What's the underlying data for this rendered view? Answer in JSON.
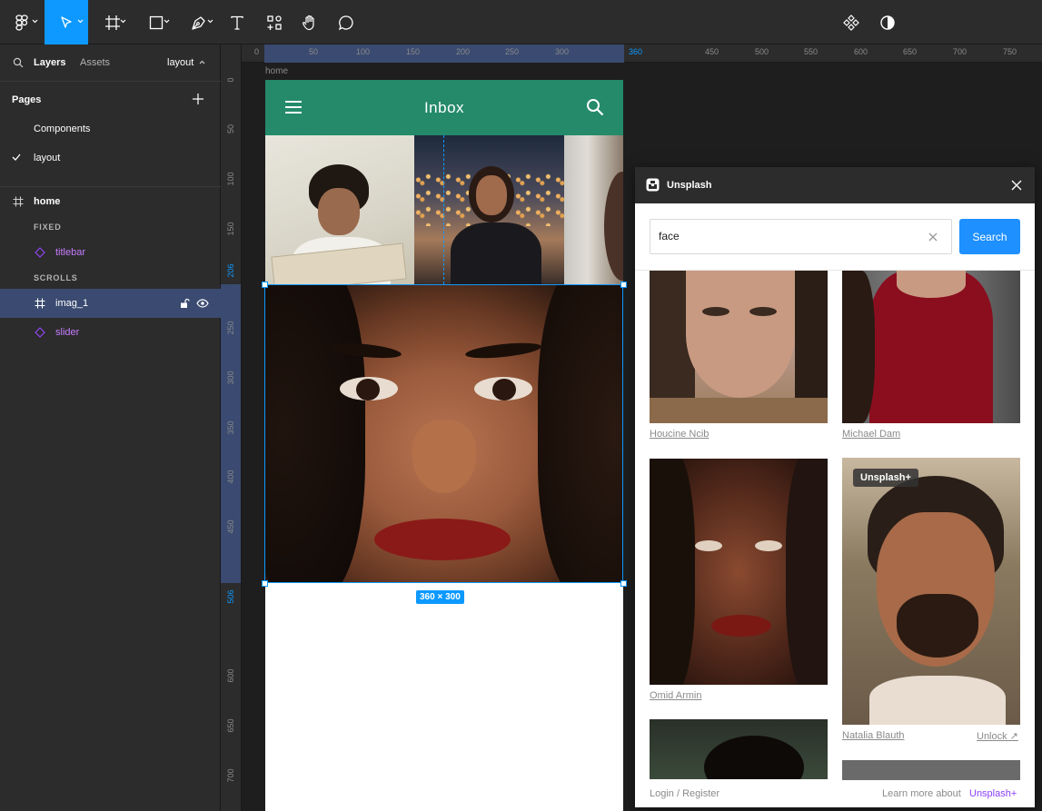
{
  "toolbar": {
    "tools": [
      "figma-menu",
      "move-tool",
      "frame-tool",
      "shape-tool",
      "pen-tool",
      "text-tool",
      "resources-tool",
      "hand-tool",
      "comment-tool"
    ],
    "right_tools": [
      "components-icon",
      "theme-toggle-icon"
    ]
  },
  "left_panel": {
    "tabs": {
      "layers": "Layers",
      "assets": "Assets",
      "page_selector": "layout"
    },
    "pages_header": "Pages",
    "pages": [
      "Components",
      "layout"
    ],
    "selected_page": "layout",
    "layers": {
      "frame": "home",
      "fixed_section": "FIXED",
      "fixed_items": [
        "titlebar"
      ],
      "scrolls_section": "SCROLLS",
      "imag": "imag_1",
      "slider": "slider"
    }
  },
  "rulers": {
    "top": [
      "0",
      "50",
      "100",
      "150",
      "200",
      "250",
      "300",
      "360",
      "450",
      "500",
      "550",
      "600",
      "650",
      "700",
      "750"
    ],
    "left": [
      "0",
      "50",
      "100",
      "150",
      "206",
      "250",
      "300",
      "350",
      "400",
      "450",
      "506",
      "600",
      "650",
      "700"
    ]
  },
  "canvas": {
    "frame_label": "home",
    "app_title": "Inbox",
    "selection_size": "360 × 300"
  },
  "unsplash": {
    "title": "Unsplash",
    "search_value": "face",
    "search_button": "Search",
    "credits": [
      "Houcine Ncib",
      "Michael Dam",
      "Omid Armin",
      "Natalia Blauth"
    ],
    "plus_badge": "Unsplash+",
    "unlock": "Unlock ↗",
    "login": "Login / Register",
    "learn_more": "Learn more about",
    "learn_more_link": "Unsplash+"
  },
  "colors": {
    "accent": "#0d99ff",
    "titlebar": "#248a6a",
    "unsplash_plus": "#8a3ffc",
    "layer_component": "#c77dff"
  }
}
